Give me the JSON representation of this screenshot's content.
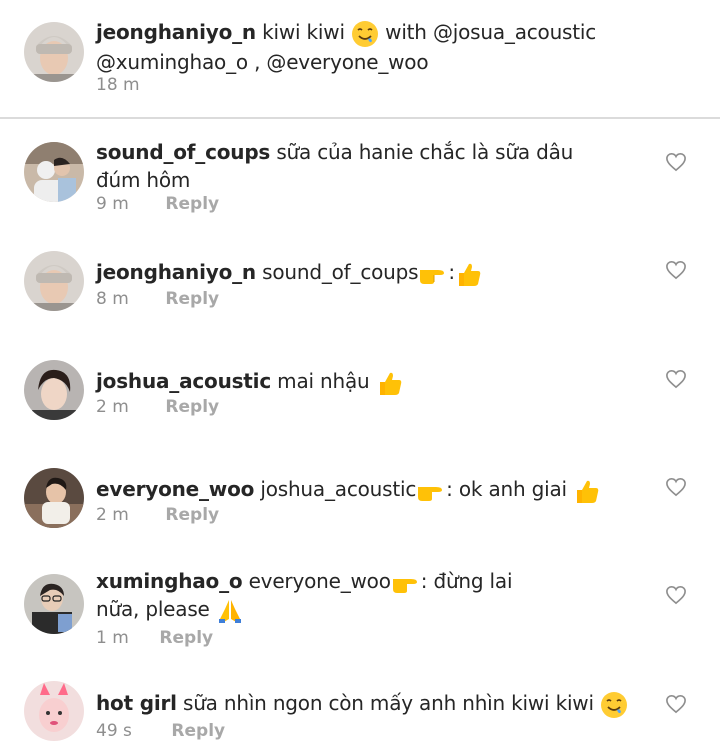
{
  "caption": {
    "username": "jeonghaniyo_n",
    "text_before_emoji": "kiwi kiwi",
    "emoji": "drooling-face-emoji",
    "text_after_emoji": "with @josua_acoustic",
    "text_line2": "@xuminghao_o , @everyone_woo",
    "time": "18 m"
  },
  "comments": [
    {
      "username": "sound_of_coups",
      "line1": "sữa của hanie chắc là sữa dâu",
      "line2": "đúm hôm",
      "time": "9 m",
      "reply": "Reply",
      "avatar": "avatar-two-people"
    },
    {
      "username": "jeonghaniyo_n",
      "text": "sound_of_coups",
      "sep": ":",
      "emojis": [
        "pointing-right-emoji",
        "thumbs-up-emoji"
      ],
      "time": "8 m",
      "reply": "Reply",
      "avatar": "avatar-beanie"
    },
    {
      "username": "joshua_acoustic",
      "text": "mai nhậu",
      "emojis": [
        "thumbs-up-emoji"
      ],
      "time": "2 m",
      "reply": "Reply",
      "avatar": "avatar-dark-hair"
    },
    {
      "username": "everyone_woo",
      "text": "joshua_acoustic",
      "sep": ":",
      "text_after": "ok anh giai",
      "emojis": [
        "pointing-right-emoji",
        "thumbs-up-emoji"
      ],
      "time": "2 m",
      "reply": "Reply",
      "avatar": "avatar-cafe"
    },
    {
      "username": "xuminghao_o",
      "text": "everyone_woo",
      "sep": ":",
      "text_after": "đừng lai",
      "line2": "nữa, please",
      "emojis": [
        "pointing-right-emoji",
        "folded-hands-emoji"
      ],
      "time": "1 m",
      "reply": "Reply",
      "avatar": "avatar-glasses"
    },
    {
      "username": "hot girl",
      "text": "sữa nhìn ngon còn mấy anh nhìn kiwi kiwi",
      "emojis": [
        "drooling-face-emoji"
      ],
      "time": "49 s",
      "reply": "Reply",
      "avatar": "avatar-bunny-filter"
    }
  ],
  "colors": {
    "text": "#262626",
    "meta": "#8e8e8e",
    "divider": "#dbdbdb",
    "heart": "#8e8e8e",
    "emoji": "#ffcc33"
  },
  "icons": {
    "like": "heart-outline-icon"
  }
}
